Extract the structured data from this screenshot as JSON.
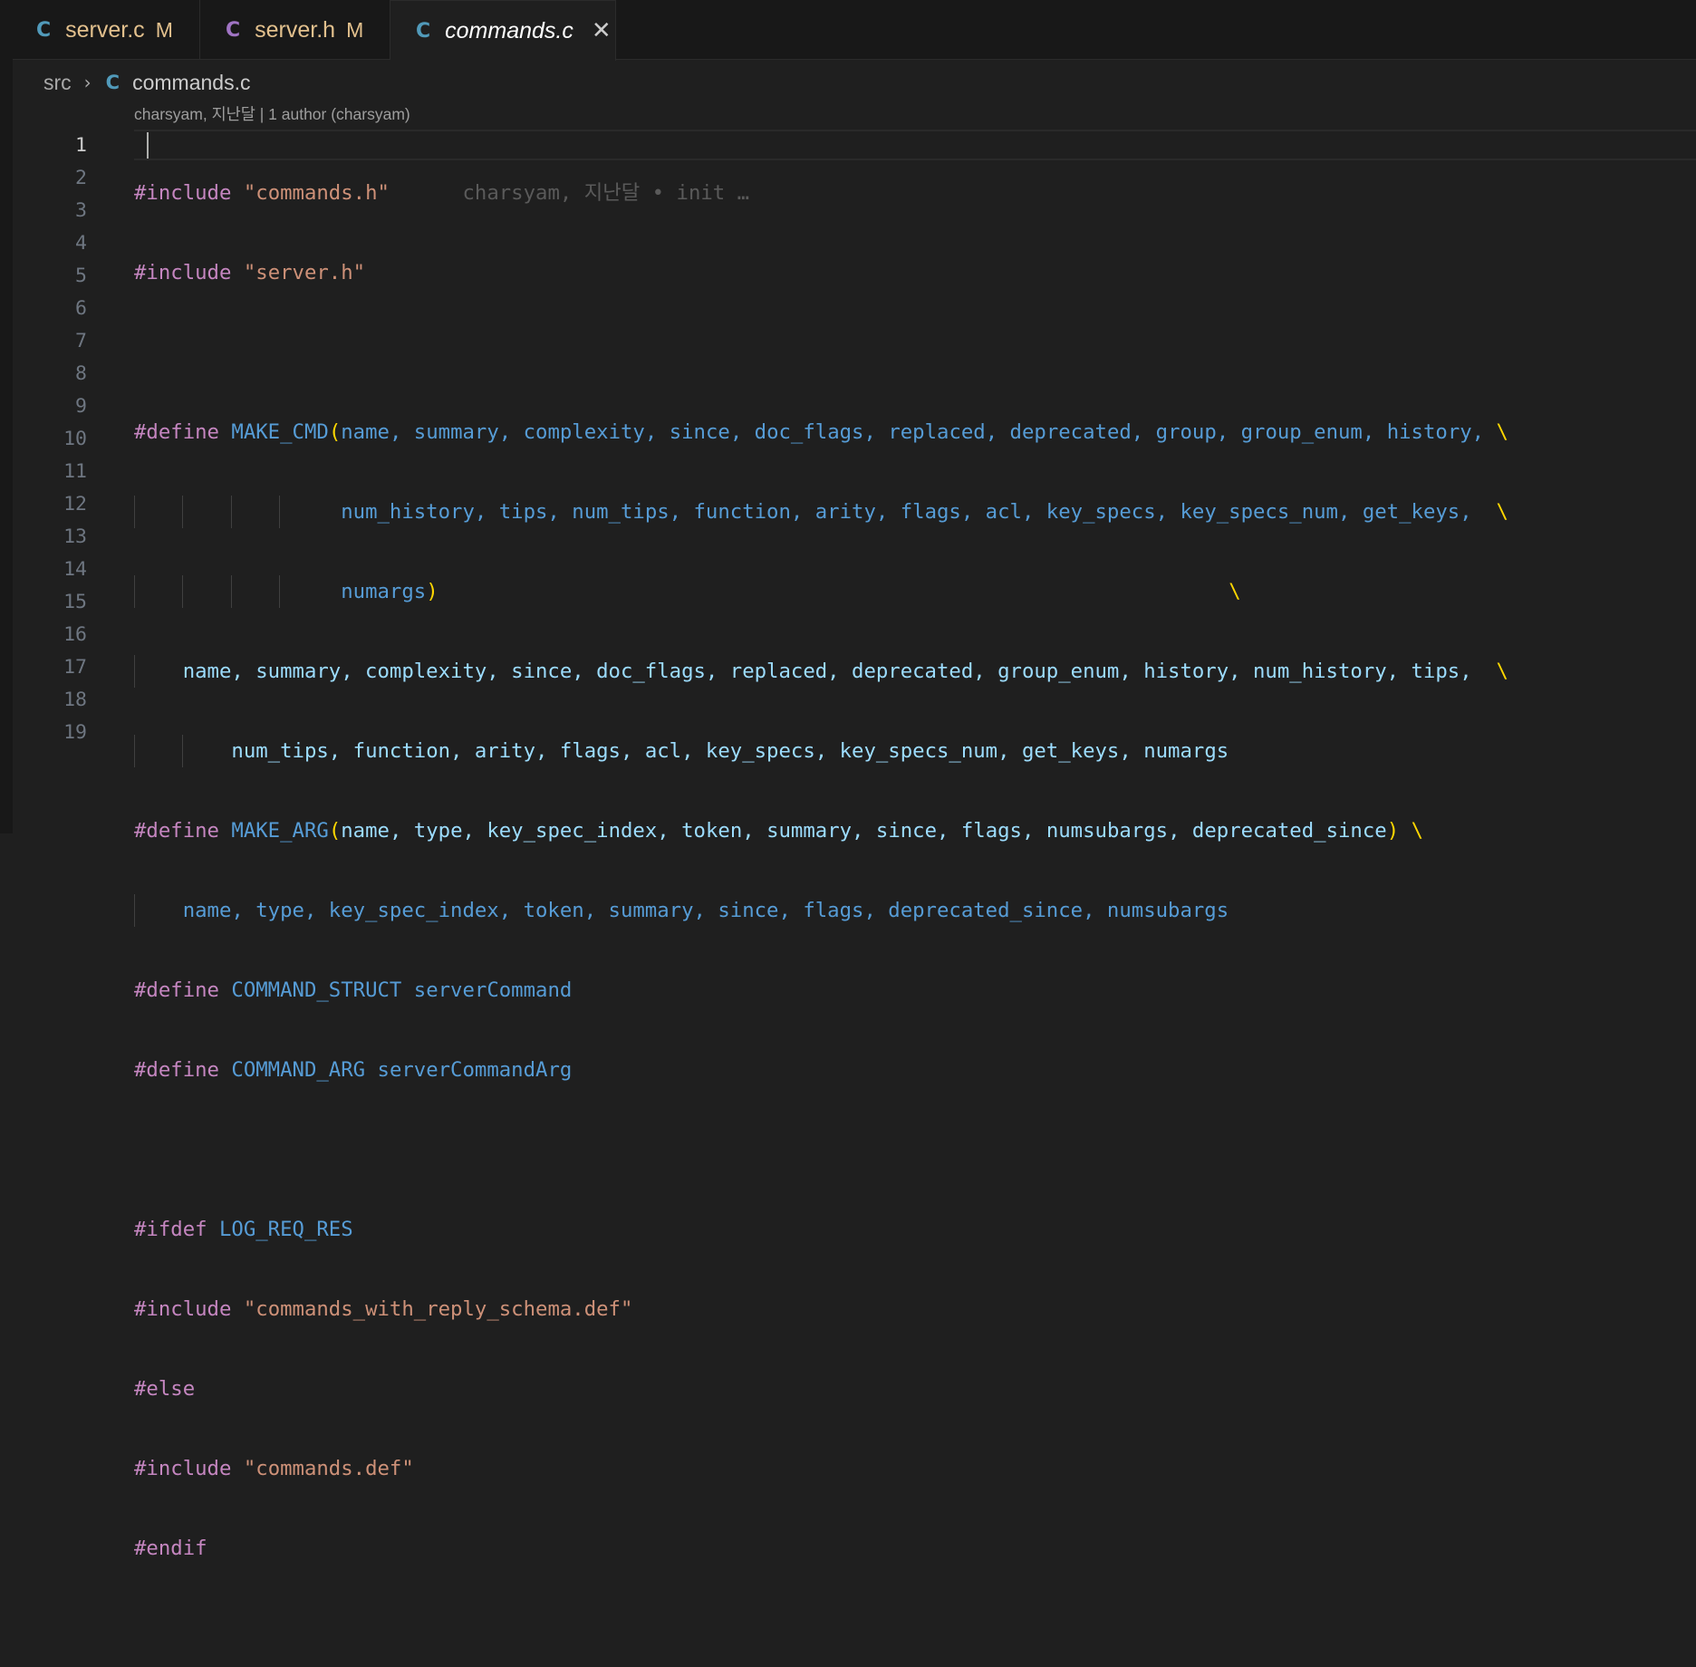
{
  "tabs": [
    {
      "icon": "C",
      "icon_kind": "c",
      "name": "server.c",
      "status": "M",
      "active": false
    },
    {
      "icon": "C",
      "icon_kind": "h",
      "name": "server.h",
      "status": "M",
      "active": false
    },
    {
      "icon": "C",
      "icon_kind": "c",
      "name": "commands.c",
      "status": "",
      "active": true,
      "close": "✕"
    }
  ],
  "breadcrumb": {
    "folder": "src",
    "separator": "›",
    "file_icon": "C",
    "file": "commands.c"
  },
  "codelens": "charsyam, 지난달 | 1 author (charsyam)",
  "line_numbers": [
    "1",
    "2",
    "3",
    "4",
    "5",
    "6",
    "7",
    "8",
    "9",
    "10",
    "11",
    "12",
    "13",
    "14",
    "15",
    "16",
    "17",
    "18",
    "19"
  ],
  "active_line": 1,
  "code": {
    "l1": {
      "kw": "#include",
      "s": "\"commands.h\"",
      "blame": "charsyam, 지난달 • init …"
    },
    "l2": {
      "kw": "#include",
      "s": "\"server.h\""
    },
    "l4": {
      "kw": "#define",
      "m": "MAKE_CMD",
      "open": "(",
      "params": "name, summary, complexity, since, doc_flags, replaced, deprecated, group, group_enum, history,",
      "bs": "\\"
    },
    "l5": {
      "params": "num_history, tips, num_tips, function, arity, flags, acl, key_specs, key_specs_num, get_keys,",
      "bs": "\\"
    },
    "l6": {
      "params": "numargs",
      "close": ")",
      "bs": "\\"
    },
    "l7": {
      "body": "name, summary, complexity, since, doc_flags, replaced, deprecated, group_enum, history, num_history, tips,",
      "bs": "\\"
    },
    "l8": {
      "body": "num_tips, function, arity, flags, acl, key_specs, key_specs_num, get_keys, numargs"
    },
    "l9": {
      "kw": "#define",
      "m": "MAKE_ARG",
      "open": "(",
      "params": "name, type, key_spec_index, token, summary, since, flags, numsubargs, deprecated_since",
      "close": ")",
      "bs": "\\"
    },
    "l10": {
      "body": "name, type, key_spec_index, token, summary, since, flags, deprecated_since, numsubargs"
    },
    "l11": {
      "kw": "#define",
      "m": "COMMAND_STRUCT",
      "v": "serverCommand"
    },
    "l12": {
      "kw": "#define",
      "m": "COMMAND_ARG",
      "v": "serverCommandArg"
    },
    "l14": {
      "kw": "#ifdef",
      "m": "LOG_REQ_RES"
    },
    "l15": {
      "kw": "#include",
      "s": "\"commands_with_reply_schema.def\""
    },
    "l16": {
      "kw": "#else"
    },
    "l17": {
      "kw": "#include",
      "s": "\"commands.def\""
    },
    "l18": {
      "kw": "#endif"
    }
  },
  "colors": {
    "background": "#1f1f1f",
    "preprocessor": "#c586c0",
    "string": "#ce9178",
    "macro": "#569cd6",
    "parameter": "#9cdcfe",
    "bracket": "#ffd700",
    "modified": "#e2c08d"
  }
}
